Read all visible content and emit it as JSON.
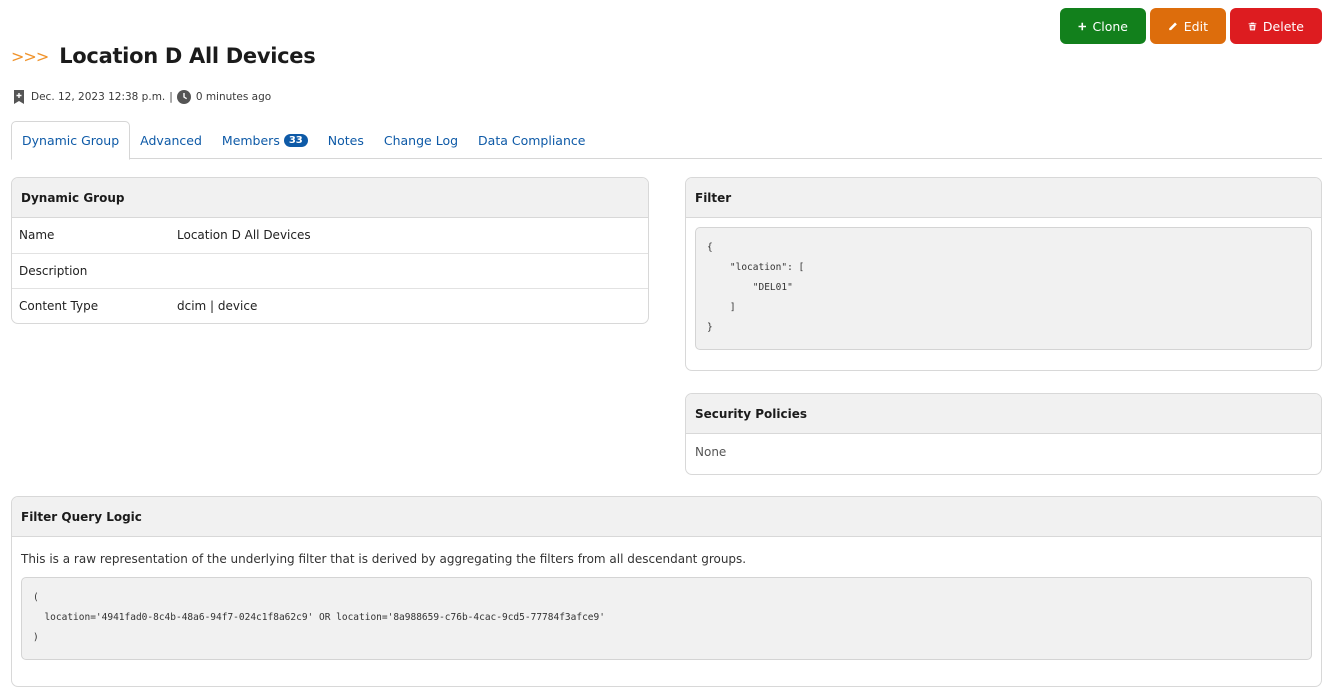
{
  "header": {
    "title": "Location D All Devices",
    "chevrons": ">>>",
    "created": "Dec. 12, 2023 12:38 p.m.",
    "separator": "|",
    "updated": "0 minutes ago"
  },
  "actions": {
    "clone_label": "Clone",
    "edit_label": "Edit",
    "delete_label": "Delete",
    "colors": {
      "clone": "#12801c",
      "edit": "#dd6d0c",
      "delete": "#dd1c20"
    }
  },
  "tabs": [
    {
      "label": "Dynamic Group",
      "active": true
    },
    {
      "label": "Advanced"
    },
    {
      "label": "Members",
      "badge": "33"
    },
    {
      "label": "Notes"
    },
    {
      "label": "Change Log"
    },
    {
      "label": "Data Compliance"
    }
  ],
  "dynamic_group": {
    "heading": "Dynamic Group",
    "rows": [
      {
        "key": "Name",
        "value": "Location D All Devices"
      },
      {
        "key": "Description",
        "value": ""
      },
      {
        "key": "Content Type",
        "value": "dcim | device"
      }
    ]
  },
  "filter": {
    "heading": "Filter",
    "code": "{\n    \"location\": [\n        \"DEL01\"\n    ]\n}"
  },
  "security_policies": {
    "heading": "Security Policies",
    "value": "None"
  },
  "filter_query_logic": {
    "heading": "Filter Query Logic",
    "description": "This is a raw representation of the underlying filter that is derived by aggregating the filters from all descendant groups.",
    "code": "(\n  location='4941fad0-8c4b-48a6-94f7-024c1f8a62c9' OR location='8a988659-c76b-4cac-9cd5-77784f3afce9'\n)"
  }
}
